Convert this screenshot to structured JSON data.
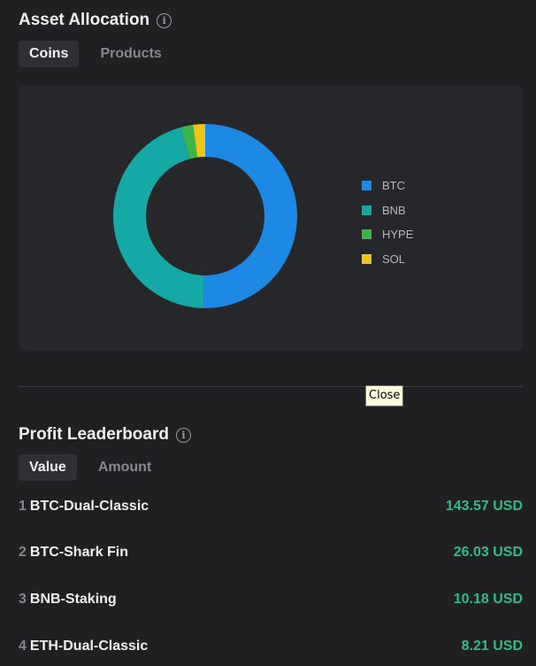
{
  "asset_allocation": {
    "title": "Asset Allocation",
    "tabs": [
      {
        "label": "Coins",
        "active": true
      },
      {
        "label": "Products",
        "active": false
      }
    ],
    "info_icon": "info-circle-icon"
  },
  "chart_data": {
    "type": "pie",
    "categories": [
      "BTC",
      "BNB",
      "HYPE",
      "SOL"
    ],
    "values": [
      50.3,
      45.5,
      2.1,
      2.1
    ],
    "colors": [
      "#1e88e5",
      "#16a8a4",
      "#3cb54a",
      "#f0c419"
    ],
    "legend_position": "right"
  },
  "tooltip": {
    "text": "Close"
  },
  "profit_leaderboard": {
    "title": "Profit Leaderboard",
    "tabs": [
      {
        "label": "Value",
        "active": true
      },
      {
        "label": "Amount",
        "active": false
      }
    ],
    "info_icon": "info-circle-icon",
    "rows": [
      {
        "rank": "1",
        "product": "BTC-Dual-Classic",
        "profit": "143.57 USD"
      },
      {
        "rank": "2",
        "product": "BTC-Shark Fin",
        "profit": "26.03 USD"
      },
      {
        "rank": "3",
        "product": "BNB-Staking",
        "profit": "10.18 USD"
      },
      {
        "rank": "4",
        "product": "ETH-Dual-Classic",
        "profit": "8.21 USD"
      }
    ]
  }
}
